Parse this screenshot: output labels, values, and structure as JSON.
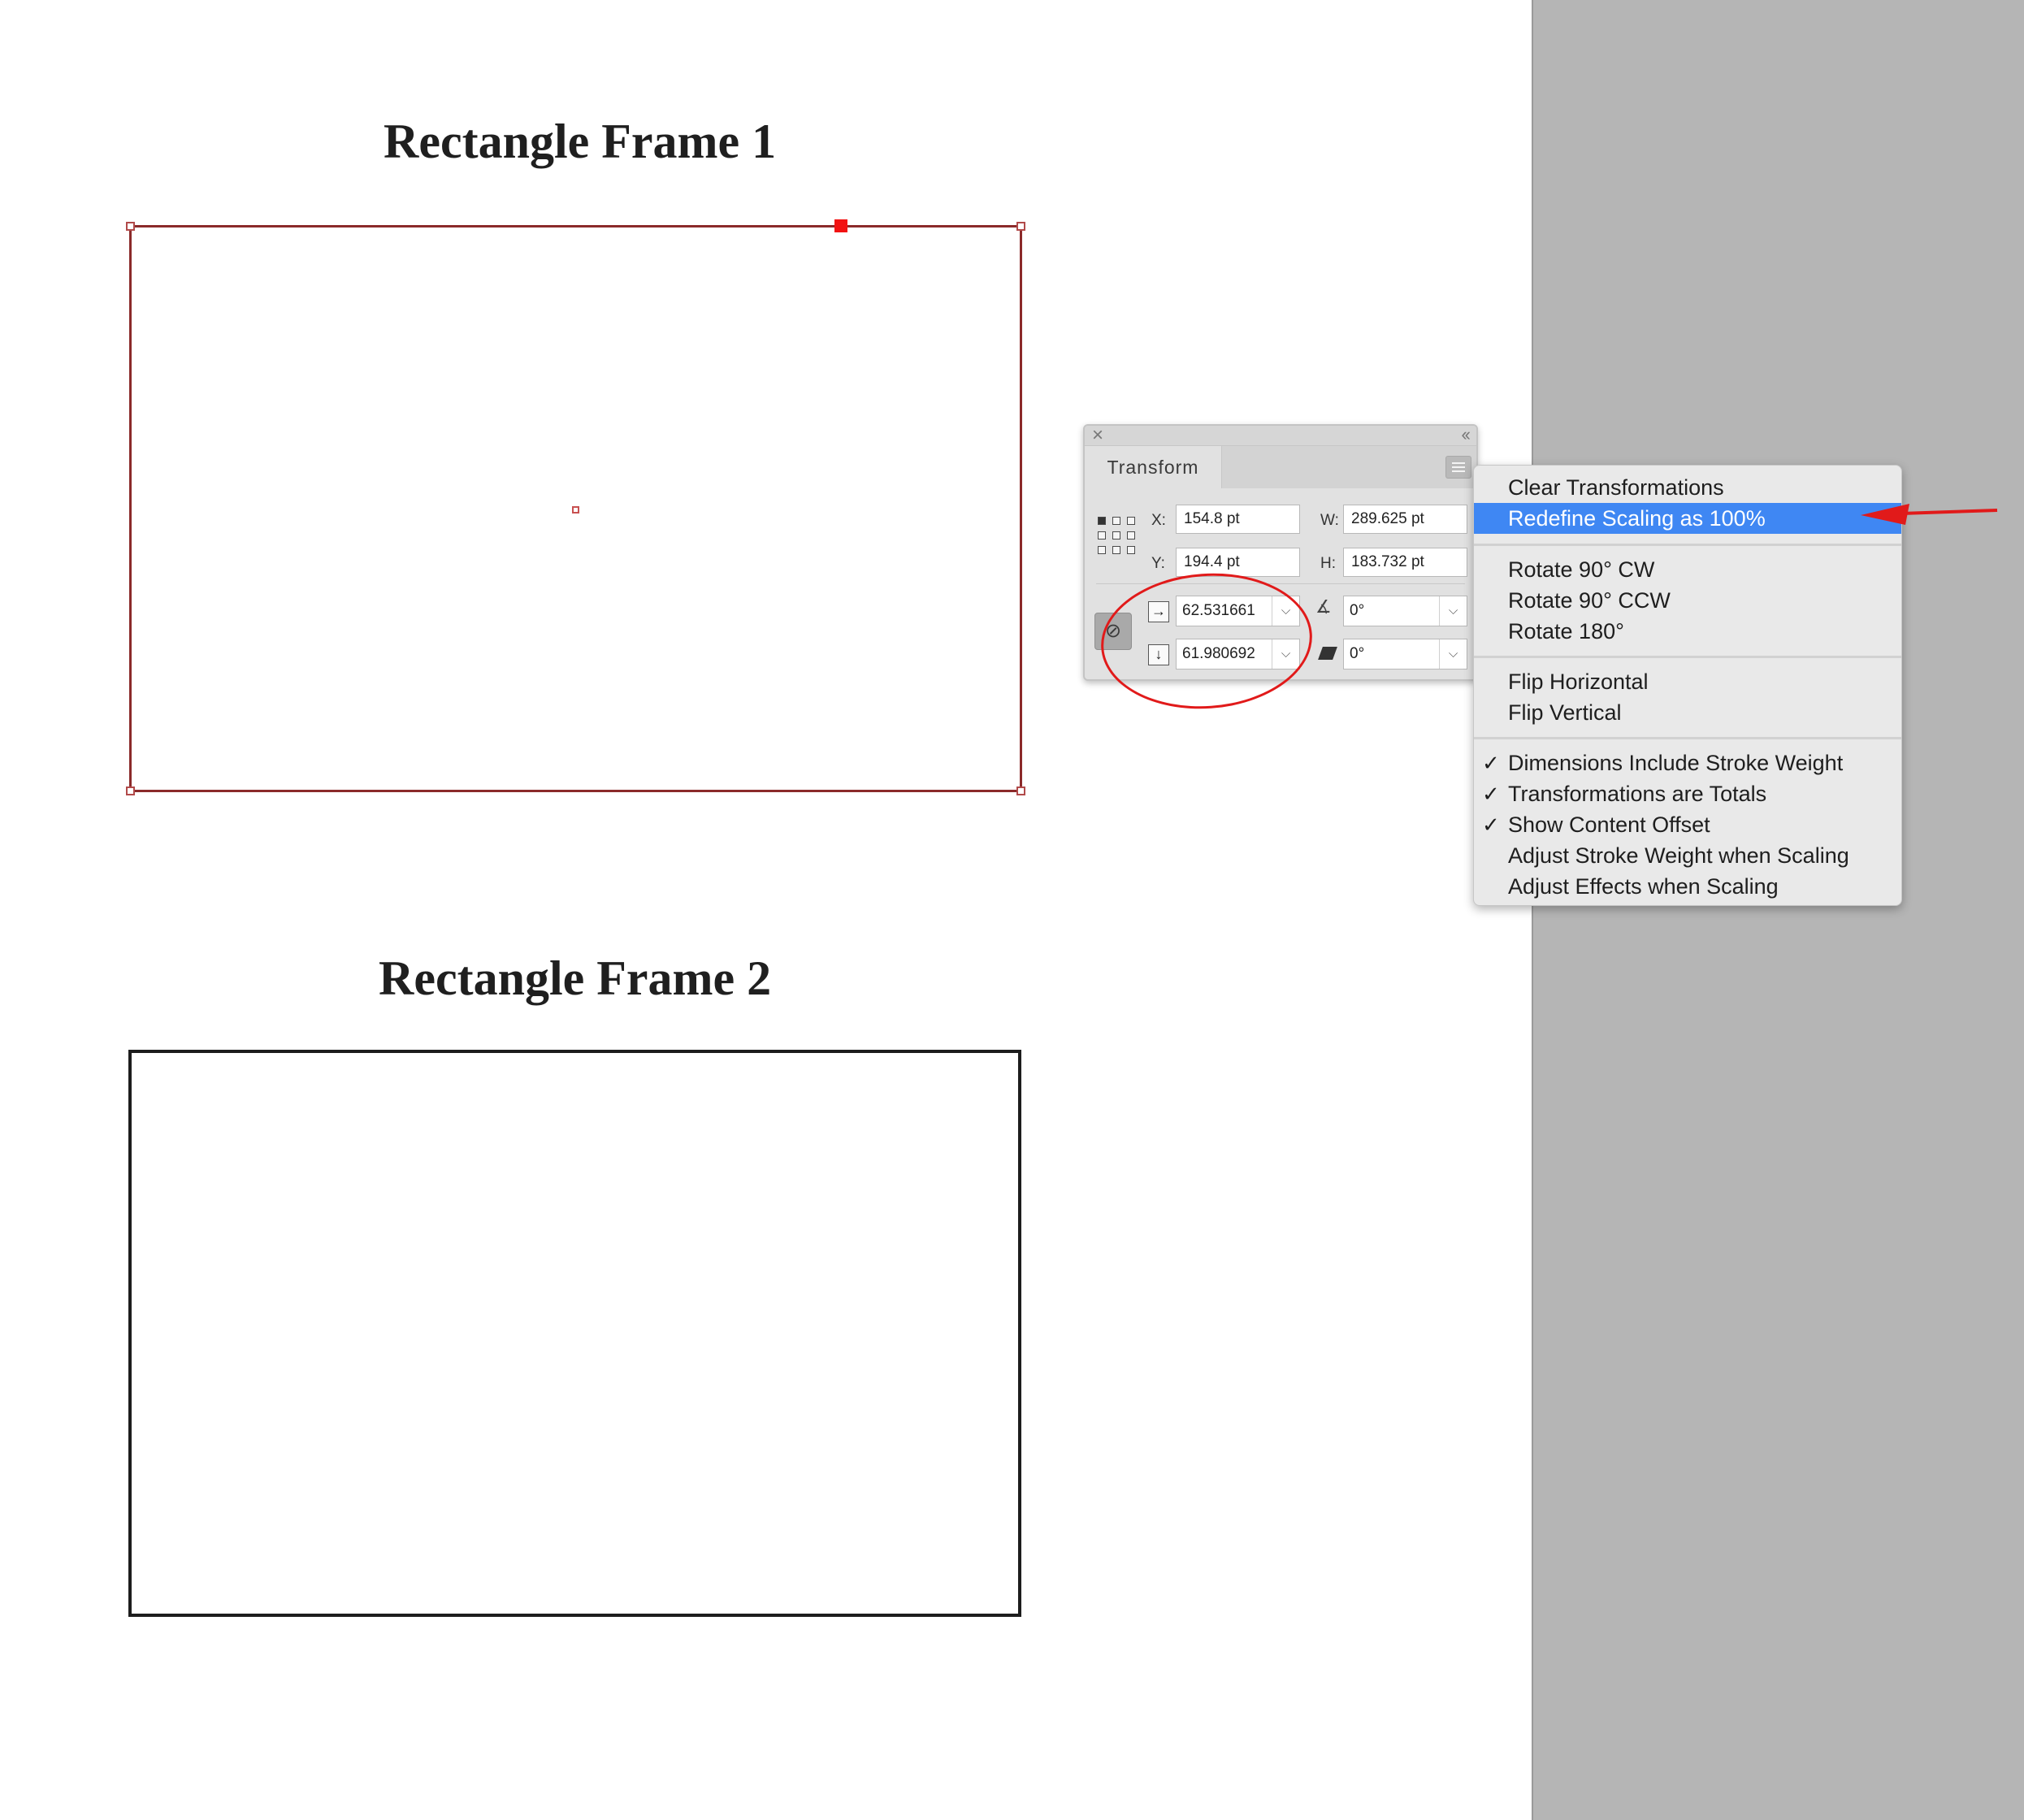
{
  "canvas": {
    "frame1_title": "Rectangle Frame 1",
    "frame2_title": "Rectangle Frame 2"
  },
  "transform_panel": {
    "tab_label": "Transform",
    "x_label": "X:",
    "x_value": "154.8 pt",
    "y_label": "Y:",
    "y_value": "194.4 pt",
    "w_label": "W:",
    "w_value": "289.625 pt",
    "h_label": "H:",
    "h_value": "183.732 pt",
    "scale_x_value": "62.531661",
    "scale_y_value": "61.980692",
    "rotation_value": "0°",
    "shear_value": "0°"
  },
  "flyout_menu": {
    "items": [
      {
        "label": "Clear Transformations",
        "checked": false
      },
      {
        "label": "Redefine Scaling as 100%",
        "checked": false,
        "highlighted": true
      },
      {
        "label": "Rotate 90° CW",
        "checked": false
      },
      {
        "label": "Rotate 90° CCW",
        "checked": false
      },
      {
        "label": "Rotate 180°",
        "checked": false
      },
      {
        "label": "Flip Horizontal",
        "checked": false
      },
      {
        "label": "Flip Vertical",
        "checked": false
      },
      {
        "label": "Dimensions Include Stroke Weight",
        "checked": true
      },
      {
        "label": "Transformations are Totals",
        "checked": true
      },
      {
        "label": "Show Content Offset",
        "checked": true
      },
      {
        "label": "Adjust Stroke Weight when Scaling",
        "checked": false
      },
      {
        "label": "Adjust Effects when Scaling",
        "checked": false
      }
    ],
    "check_glyph": "✓"
  },
  "colors": {
    "menu_highlight": "#3f87f3",
    "annotation_red": "#e11a1a",
    "selected_frame": "#8b2a2a",
    "pasteboard": "#b5b5b5"
  },
  "icons": {
    "reference_point": "reference-point-grid-icon",
    "constrain_proportions": "link-icon",
    "scale_x": "scale-x-icon",
    "scale_y": "scale-y-icon",
    "rotation": "rotation-angle-icon",
    "shear": "shear-icon",
    "panel_menu": "hamburger-menu-icon"
  }
}
